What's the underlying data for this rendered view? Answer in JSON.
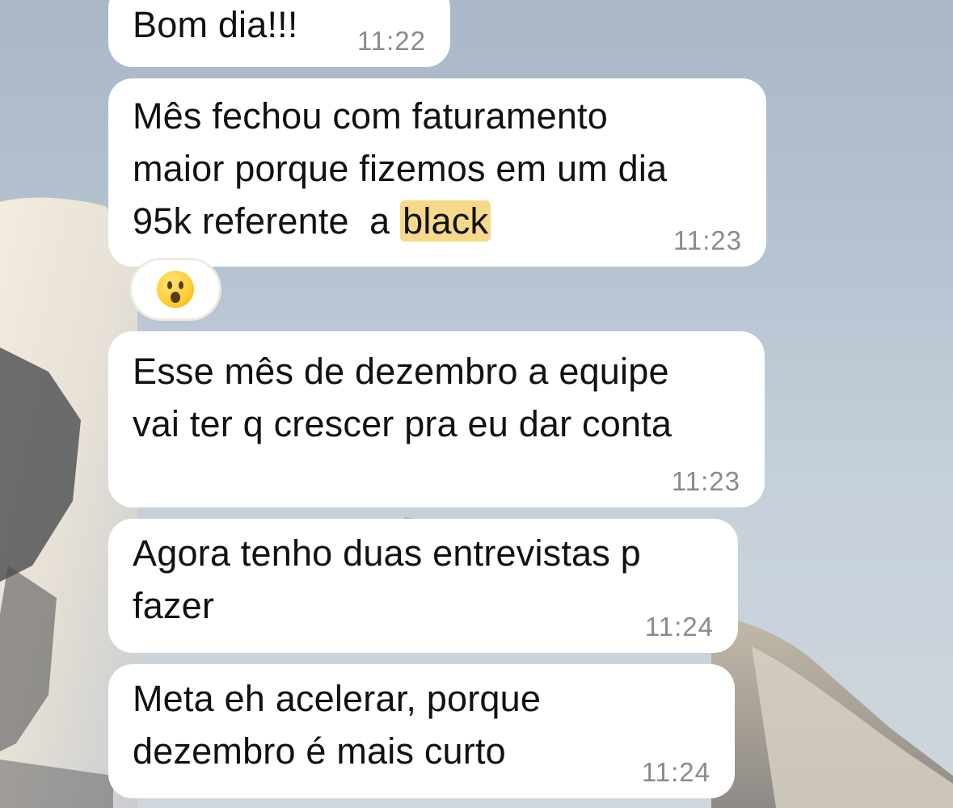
{
  "messages": [
    {
      "text_lines": [
        "Bom dia!!!"
      ],
      "time": "11:22"
    },
    {
      "text_lines": [
        "Mês fechou com faturamento",
        "maior porque fizemos em um dia",
        "95k referente  a "
      ],
      "highlight": "black",
      "time": "11:23",
      "reaction": "astonished-face-emoji"
    },
    {
      "text_lines": [
        "Esse mês de dezembro a equipe",
        "vai ter q crescer pra eu dar conta"
      ],
      "time": "11:23"
    },
    {
      "text_lines": [
        "Agora tenho duas entrevistas p",
        "fazer"
      ],
      "time": "11:24"
    },
    {
      "text_lines": [
        "Meta eh acelerar, porque",
        "dezembro é mais curto"
      ],
      "time": "11:24"
    }
  ],
  "colors": {
    "bubble": "#ffffff",
    "text": "#111111",
    "timestamp": "#8a8a8f",
    "highlight": "#f7d98a",
    "sky": "#b5c2d0"
  }
}
